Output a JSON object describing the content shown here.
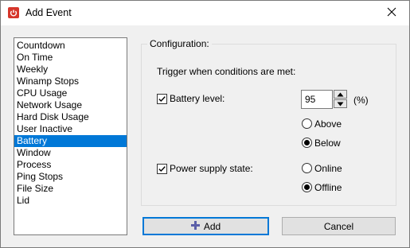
{
  "window": {
    "title": "Add Event"
  },
  "event_list": {
    "items": [
      "Countdown",
      "On Time",
      "Weekly",
      "Winamp Stops",
      "CPU Usage",
      "Network Usage",
      "Hard Disk Usage",
      "User Inactive",
      "Battery",
      "Window",
      "Process",
      "Ping Stops",
      "File Size",
      "Lid"
    ],
    "selected": "Battery"
  },
  "configuration": {
    "title": "Configuration:",
    "trigger_text": "Trigger when conditions are met:",
    "battery_level": {
      "label": "Battery level:",
      "checked": true,
      "value": "95",
      "unit": "(%)"
    },
    "battery_options": {
      "above": "Above",
      "below": "Below",
      "selected": "Below"
    },
    "power_supply": {
      "label": "Power supply state:",
      "checked": true
    },
    "power_options": {
      "online": "Online",
      "offline": "Offline",
      "selected": "Offline"
    }
  },
  "buttons": {
    "add": "Add",
    "cancel": "Cancel"
  },
  "colors": {
    "selection": "#0078d7",
    "app_icon": "#d6362b",
    "add_icon": "#5b5fa8"
  }
}
